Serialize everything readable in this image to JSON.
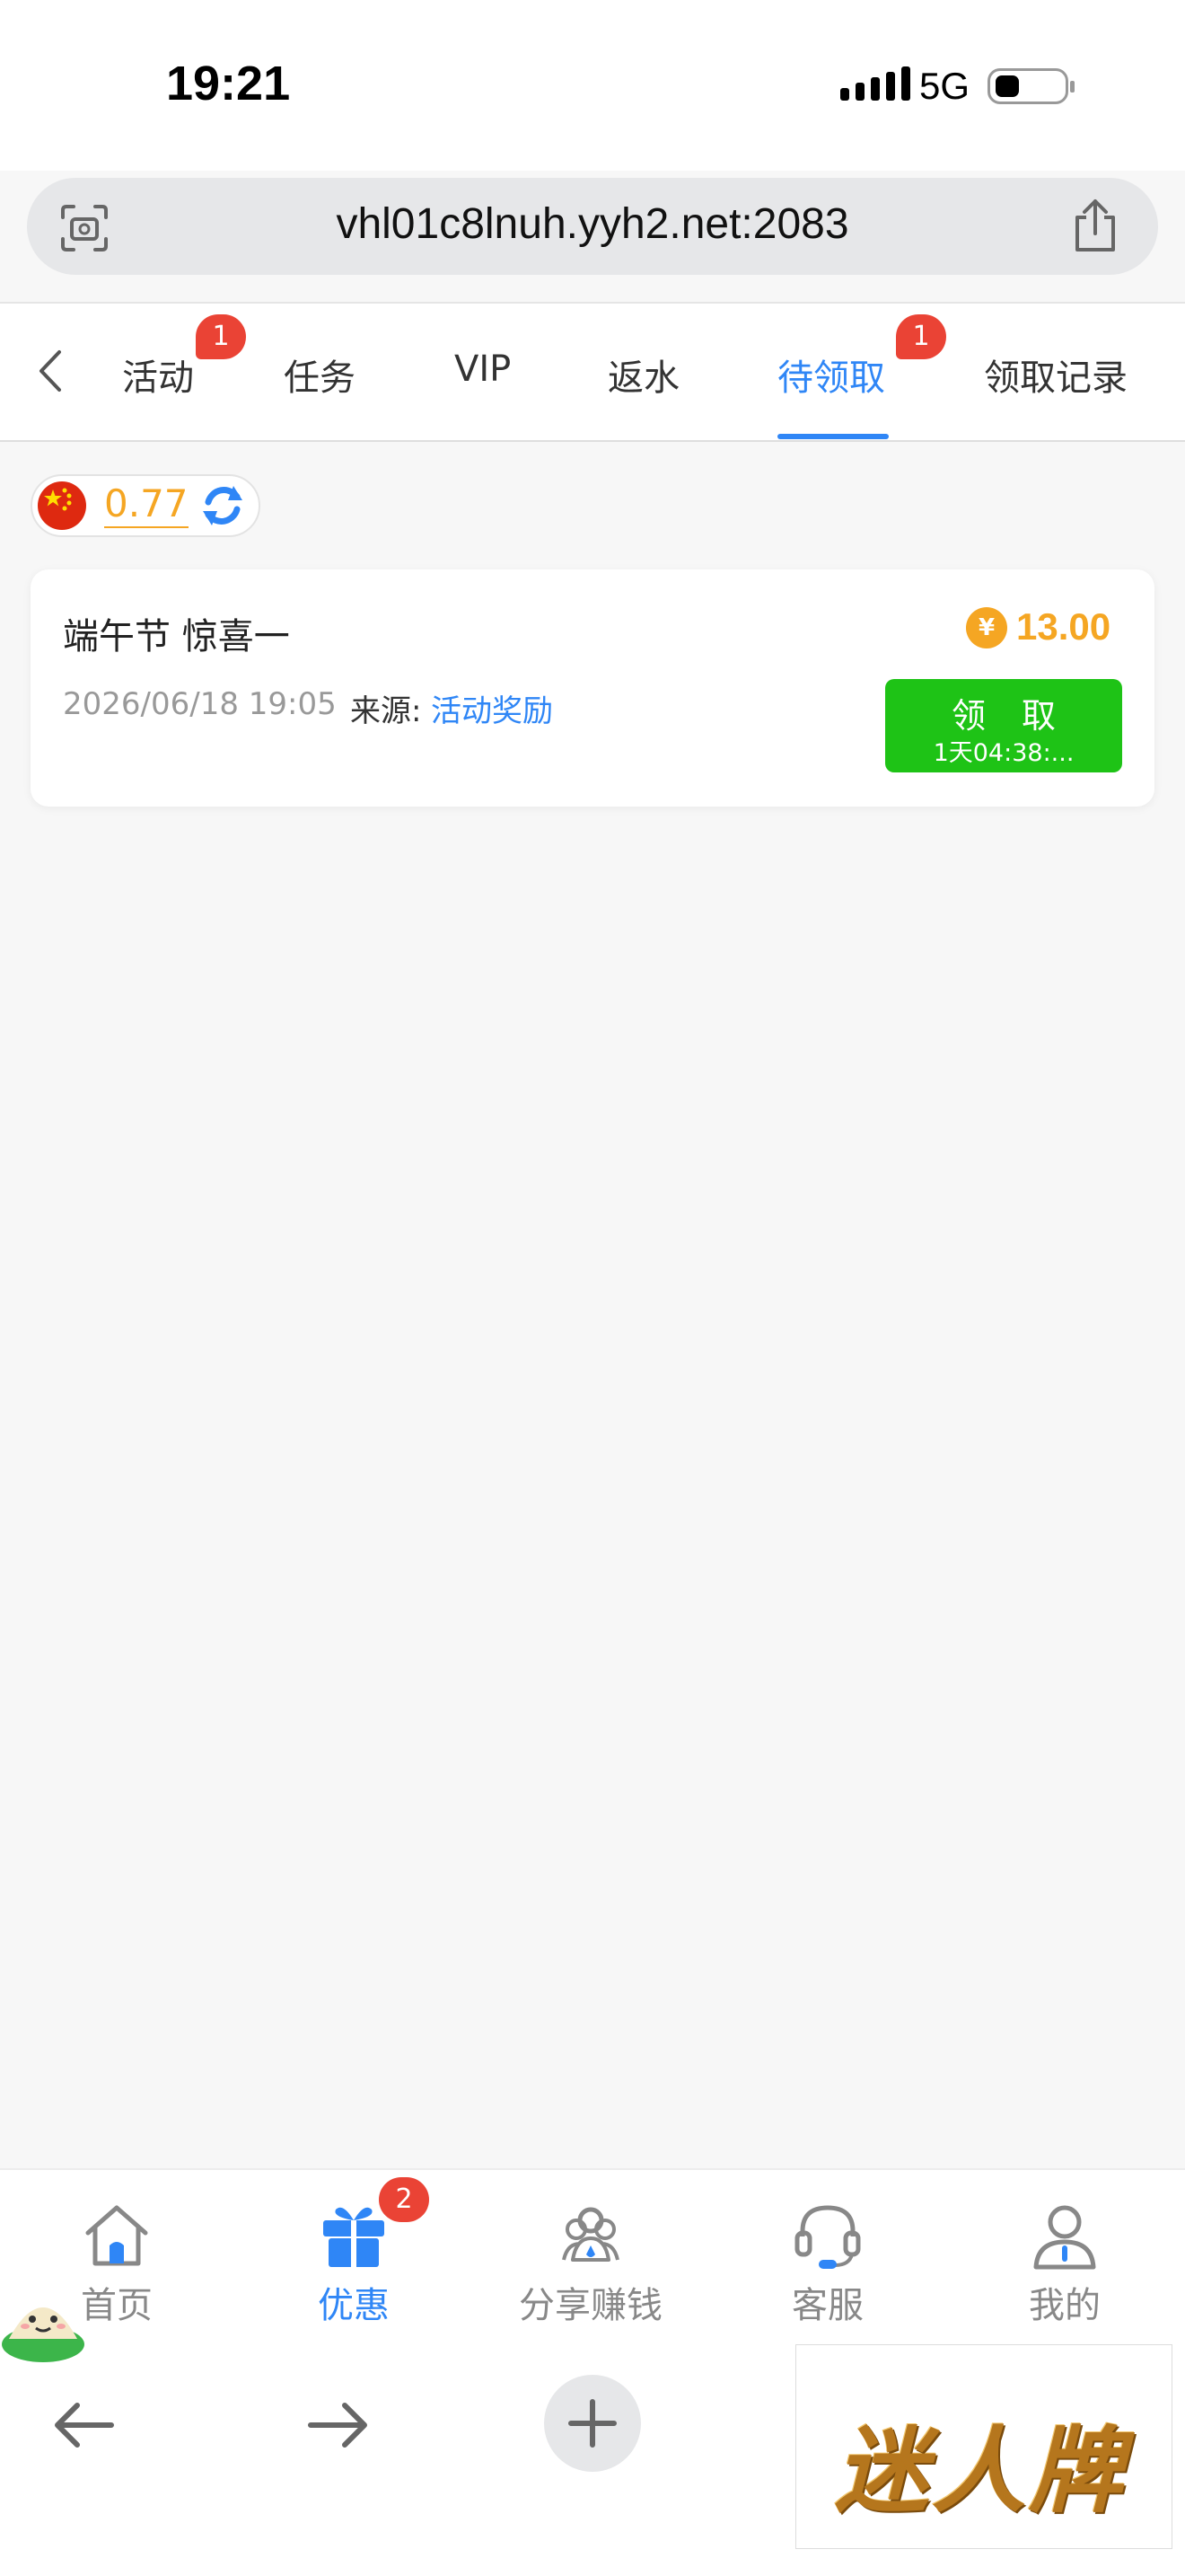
{
  "status_bar": {
    "time": "19:21",
    "network": "5G"
  },
  "browser": {
    "url": "vhl01c8lnuh.yyh2.net:2083"
  },
  "tabs": [
    {
      "label": "活动",
      "badge": "1"
    },
    {
      "label": "任务"
    },
    {
      "label": "VIP"
    },
    {
      "label": "返水"
    },
    {
      "label": "待领取",
      "badge": "1",
      "active": true
    },
    {
      "label": "领取记录"
    }
  ],
  "balance": {
    "value": "0.77"
  },
  "reward": {
    "title": "端午节 惊喜一",
    "amount": "13.00",
    "coin_symbol": "¥",
    "date": "2026/06/18 19:05",
    "source_label": "来源:",
    "source": "活动奖励",
    "claim_label": "领 取",
    "countdown": "1天04:38:..."
  },
  "bottom_nav": [
    {
      "label": "首页",
      "icon": "home-icon"
    },
    {
      "label": "优惠",
      "icon": "gift-icon",
      "badge": "2",
      "active": true
    },
    {
      "label": "分享赚钱",
      "icon": "share-users-icon"
    },
    {
      "label": "客服",
      "icon": "headset-icon"
    },
    {
      "label": "我的",
      "icon": "user-icon"
    }
  ],
  "watermark": "迷人牌",
  "colors": {
    "accent": "#2f86f6",
    "gold": "#f5a623",
    "claim_green": "#1ec316",
    "badge_red": "#ea4335"
  }
}
